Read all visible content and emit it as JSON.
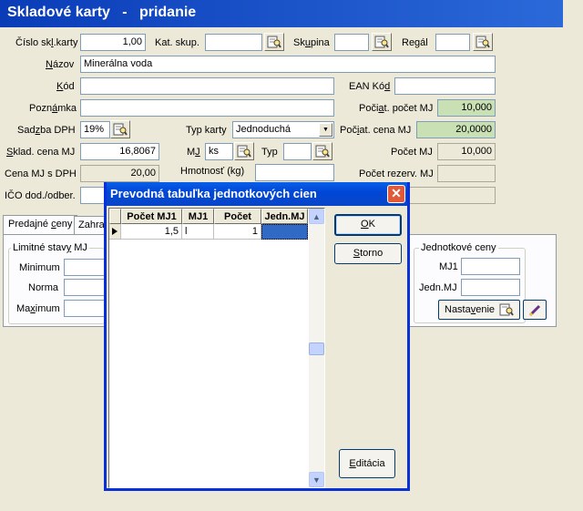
{
  "window": {
    "title": "Skladové karty   -   pridanie"
  },
  "form": {
    "cislo_label_a": "Číslo sk",
    "cislo_label_u": "l",
    "cislo_label_b": ".karty",
    "cislo_value": "1,00",
    "kat_skup_label": "Kat. skup.",
    "skupina_label_a": "Sk",
    "skupina_label_u": "u",
    "skupina_label_b": "pina",
    "regal_label": "Regál",
    "nazov_label_u": "N",
    "nazov_label_b": "ázov",
    "nazov_value": "Minerálna voda",
    "kod_label_u": "K",
    "kod_label_b": "ód",
    "ean_label_a": "EAN Kó",
    "ean_label_u": "d",
    "poznamka_label_a": "Pozn",
    "poznamka_label_u": "á",
    "poznamka_label_b": "mka",
    "pociat_pocet_label_a": "Poči",
    "pociat_pocet_label_u": "a",
    "pociat_pocet_label_b": "t. počet MJ",
    "pociat_pocet_value": "10,000",
    "sadzba_label_a": "Sad",
    "sadzba_label_u": "z",
    "sadzba_label_b": "ba DPH",
    "sadzba_value": "19%",
    "typ_karty_label": "Typ karty",
    "typ_karty_value": "Jednoduchá",
    "pociat_cena_label_a": "Poč",
    "pociat_cena_label_u": "i",
    "pociat_cena_label_b": "at. cena MJ",
    "pociat_cena_value": "20,0000",
    "sklad_cena_label_u": "S",
    "sklad_cena_label_b": "klad. cena MJ",
    "sklad_cena_value": "16,8067",
    "mj_label_a": "M",
    "mj_label_u": "J",
    "mj_value": "ks",
    "typ_label": "Typ",
    "pocet_mj_label": "Počet MJ",
    "pocet_mj_value": "10,000",
    "cena_dph_label": "Cena MJ s DPH",
    "cena_dph_value": "20,00",
    "hmotnost_label": "Hmotnosť (kg)",
    "pocet_rezerv_label": "Počet rezerv. MJ",
    "ico_label": "IČO dod./odber."
  },
  "tabs": {
    "predajne_a": "Predajné ",
    "predajne_u": "c",
    "predajne_b": "eny",
    "zahranicne": "Zahra"
  },
  "limits": {
    "title_a": "Limitné stav",
    "title_u": "y",
    "title_b": " MJ",
    "minimum": "Minimum",
    "norma": "Norma",
    "maximum_a": "Ma",
    "maximum_u": "x",
    "maximum_b": "imum"
  },
  "unit_prices": {
    "title": "Jednotkové ceny",
    "mj1": "MJ1",
    "jedn_mj": "Jedn.MJ",
    "nastavenie_a": "Nasta",
    "nastavenie_u": "v",
    "nastavenie_b": "enie"
  },
  "dialog": {
    "title": "Prevodná tabuľka jednotkových cien",
    "close": "✕",
    "columns": [
      "Počet MJ1",
      "MJ1",
      "Počet",
      "Jedn.MJ"
    ],
    "rows": [
      {
        "pocet_mj1": "1,5",
        "mj1": "l",
        "pocet": "1",
        "jedn_mj": ""
      }
    ],
    "ok_u": "O",
    "ok_b": "K",
    "storno_u": "S",
    "storno_b": "torno",
    "editacia_u": "E",
    "editacia_b": "ditácia"
  }
}
